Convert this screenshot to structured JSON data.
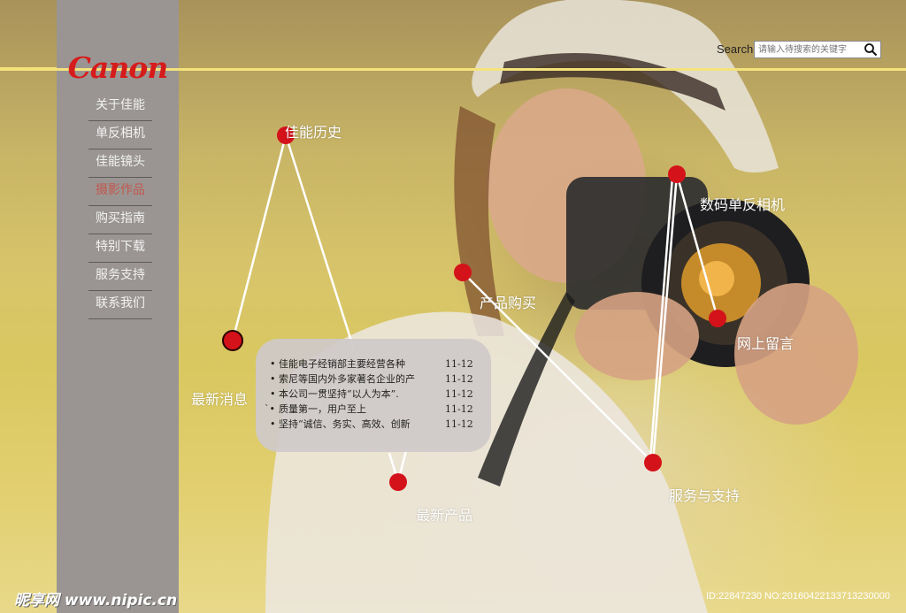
{
  "brand": {
    "logo_text": "Canon",
    "logo_color": "#d61b1b"
  },
  "search": {
    "label": "Search",
    "placeholder": "请输入待搜索的关键字",
    "icon": "search-icon"
  },
  "sidebar": {
    "items": [
      {
        "label": "关于佳能",
        "active": false
      },
      {
        "label": "单反相机",
        "active": false
      },
      {
        "label": "佳能镜头",
        "active": false
      },
      {
        "label": "摄影作品",
        "active": true
      },
      {
        "label": "购买指南",
        "active": false
      },
      {
        "label": "特别下载",
        "active": false
      },
      {
        "label": "服务支持",
        "active": false
      },
      {
        "label": "联系我们",
        "active": false
      }
    ]
  },
  "hubs": {
    "history": "佳能历史",
    "dslr": "数码单反相机",
    "purchase": "产品购买",
    "message": "网上留言",
    "news": "最新消息",
    "new_products": "最新产品",
    "service": "服务与支持"
  },
  "news": {
    "items": [
      {
        "bullet": "•",
        "text": "佳能电子经销部主要经营各种",
        "date": "11-12"
      },
      {
        "bullet": "•",
        "text": "索尼等国内外多家著名企业的产",
        "date": "11-12"
      },
      {
        "bullet": "•",
        "text": "本公司一贯坚持“以人为本”.",
        "date": "11-12"
      },
      {
        "bullet": "`•",
        "text": "质量第一，用户至上",
        "date": "11-12"
      },
      {
        "bullet": "•",
        "text": "坚持“诚信、务实、高效、创新",
        "date": "11-12"
      }
    ]
  },
  "watermark": {
    "left": "昵享网 www.nipic.cn",
    "right": "ID:22847230 NO:20160422133713230000"
  },
  "colors": {
    "accent_line": "#f4e27a",
    "sidebar": "#9a9592",
    "dot": "#d4121a",
    "active_nav": "#c4574f"
  }
}
